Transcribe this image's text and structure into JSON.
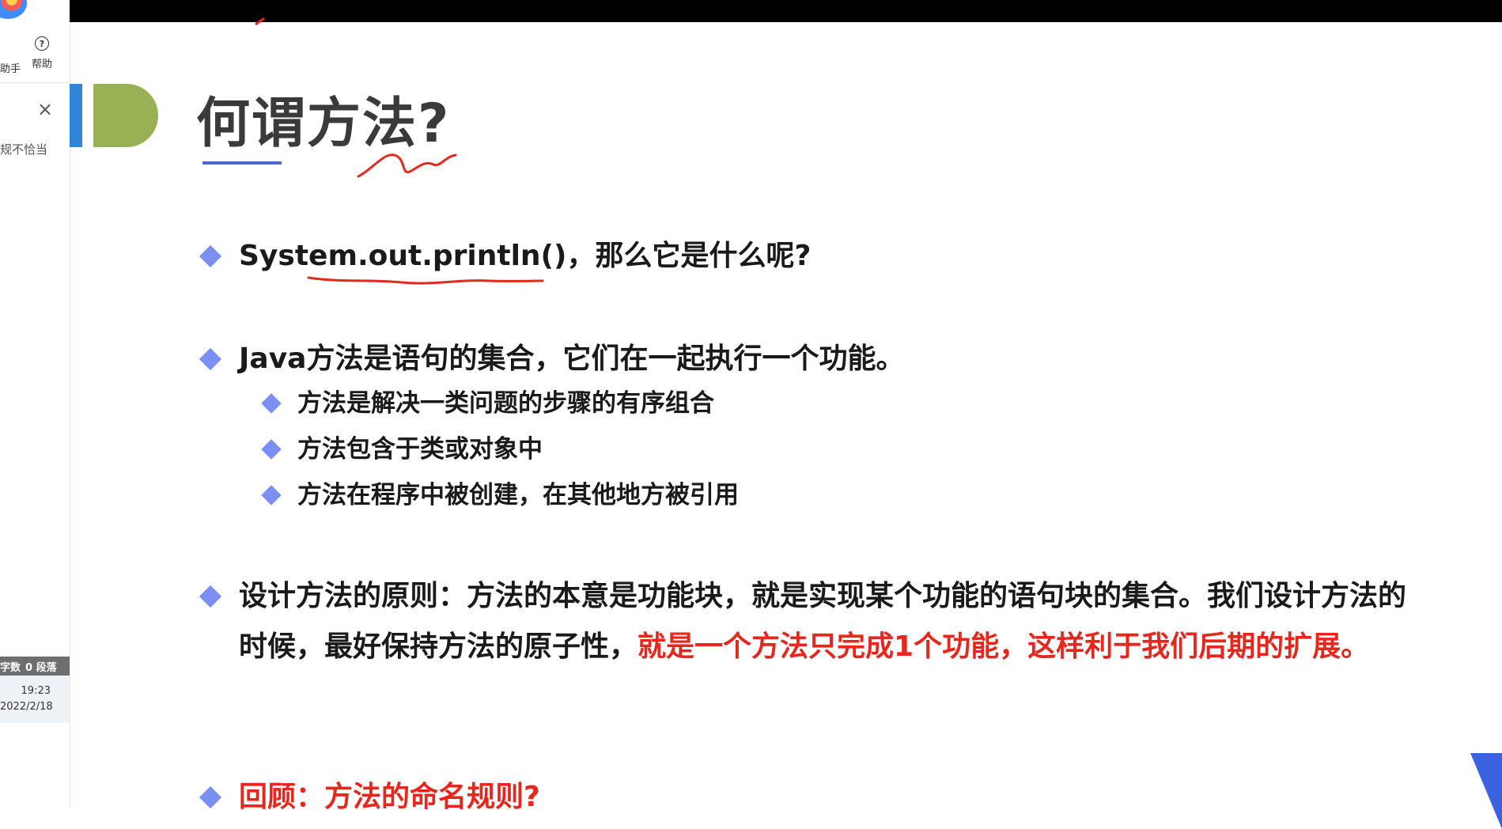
{
  "left_panel": {
    "tool_partial_label": "助手",
    "help_label": "帮助",
    "notice_text": "规不恰当",
    "status_bar": {
      "word_count_label": "字数",
      "paragraphs": "0 段落"
    },
    "clock": {
      "time": "19:23",
      "date": "2022/2/18"
    }
  },
  "slide": {
    "title": "何谓方法?",
    "bullets": [
      {
        "text": "System.out.println()，那么它是什么呢?"
      },
      {
        "text": "Java方法是语句的集合，它们在一起执行一个功能。",
        "sub": [
          "方法是解决一类问题的步骤的有序组合",
          "方法包含于类或对象中",
          "方法在程序中被创建，在其他地方被引用"
        ]
      },
      {
        "line1": "设计方法的原则：方法的本意是功能块，就是实现某个功能的语句块的集合。我们设计方法的",
        "line2_black": "时候，最好保持方法的原子性，",
        "line2_red": "就是一个方法只完成1个功能，这样利于我们后期的扩展。"
      },
      {
        "text": "回顾：方法的命名规则?"
      }
    ]
  },
  "colors": {
    "accent_blue": "#2f86d6",
    "accent_green": "#97b154",
    "bullet_diamond": "#7b8ff2",
    "highlight_red": "#e8261c",
    "annotation_red": "#e02a1e"
  }
}
